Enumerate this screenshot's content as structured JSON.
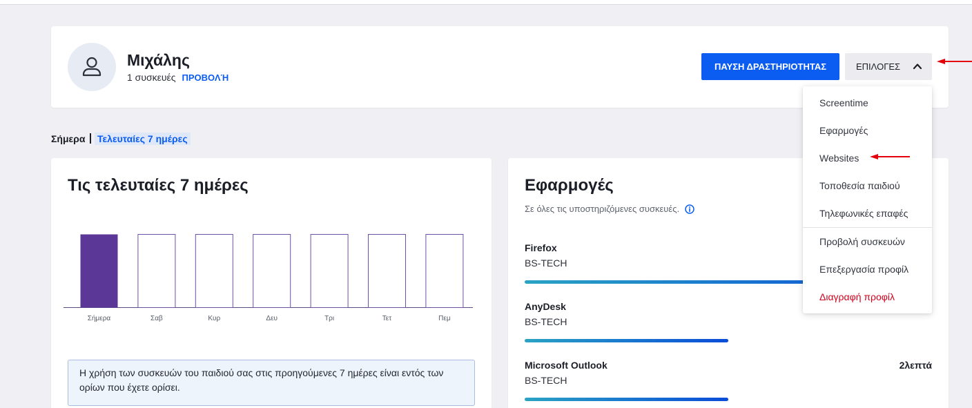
{
  "profile": {
    "avatar_icon": "user-outline-icon",
    "name": "Μιχάλης",
    "devices_count": "1 συσκευές",
    "view_link": "ΠΡΟΒΟΛΉ",
    "pause_button": "ΠΑΥΣΗ ΔΡΑΣΤΗΡΙΟΤΗΤΑΣ",
    "options_button": "ΕΠΙΛΟΓΕΣ",
    "options_icon": "chevron-up-icon"
  },
  "range_tabs": [
    {
      "label": "Σήμερα",
      "selected": false
    },
    {
      "label": "Τελευταίες 7 ημέρες",
      "selected": true
    }
  ],
  "usage_card": {
    "title": "Τις τελευταίες 7 ημέρες",
    "info_message": "Η χρήση των συσκευών του παιδιού σας στις προηγούμενες 7 ημέρες είναι εντός των ορίων που έχετε ορίσει."
  },
  "chart_data": {
    "type": "bar",
    "categories": [
      "Σήμερα",
      "Σαβ",
      "Κυρ",
      "Δευ",
      "Τρι",
      "Τετ",
      "Πεμ"
    ],
    "values": [
      1,
      1,
      1,
      1,
      1,
      1,
      1
    ],
    "filled": [
      true,
      false,
      false,
      false,
      false,
      false,
      false
    ],
    "grid": false
  },
  "apps_card": {
    "title": "Εφαρμογές",
    "subtitle": "Σε όλες τις υποστηριζόμενες συσκευές.",
    "info_icon": "info-icon",
    "apps": [
      {
        "name": "Firefox",
        "device": "BS-TECH",
        "usage_fraction": 1.0
      },
      {
        "name": "AnyDesk",
        "device": "BS-TECH",
        "usage_fraction": 0.5
      },
      {
        "name": "Microsoft Outlook",
        "device": "BS-TECH",
        "duration": "2λεπτά",
        "usage_fraction": 0.5
      }
    ]
  },
  "options_menu": {
    "open": true,
    "items": [
      {
        "label": "Screentime"
      },
      {
        "label": "Εφαρμογές"
      },
      {
        "label": "Websites"
      },
      {
        "label": "Τοποθεσία παιδιού"
      },
      {
        "label": "Τηλεφωνικές επαφές"
      },
      {
        "label": "Προβολή συσκευών"
      },
      {
        "label": "Επεξεργασία προφίλ"
      },
      {
        "label": "Διαγραφή προφίλ",
        "danger": true
      }
    ]
  },
  "colors": {
    "page_background": "#f0f0f4",
    "primary": "#0b5cf0",
    "bar_filled": "#5b3797",
    "bar_outline": "#6b4ea6",
    "chart_baseline": "#5a4a80",
    "progress_start": "#2aa3c4",
    "progress_end": "#0a4cd8",
    "danger": "#d0021b",
    "annotation_arrow": "#e3000b",
    "info_box_background": "#eef4fc"
  }
}
